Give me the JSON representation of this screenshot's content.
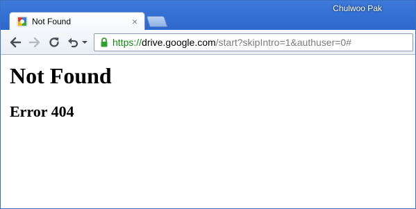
{
  "browser": {
    "user_name": "Chulwoo Pak",
    "tab": {
      "title": "Not Found",
      "favicon": "google-drive-favicon"
    },
    "address_bar": {
      "scheme": "https://",
      "host": "drive.google.com",
      "path": "/start?skipIntro=1&authuser=0#"
    },
    "toolbar_icons": [
      "back-icon",
      "forward-icon",
      "reload-icon",
      "undo-icon",
      "dropdown-icon"
    ],
    "colors": {
      "frame": "#3571d4",
      "secure_scheme": "#0f8a0f"
    }
  },
  "page": {
    "heading": "Not Found",
    "subheading": "Error 404"
  }
}
